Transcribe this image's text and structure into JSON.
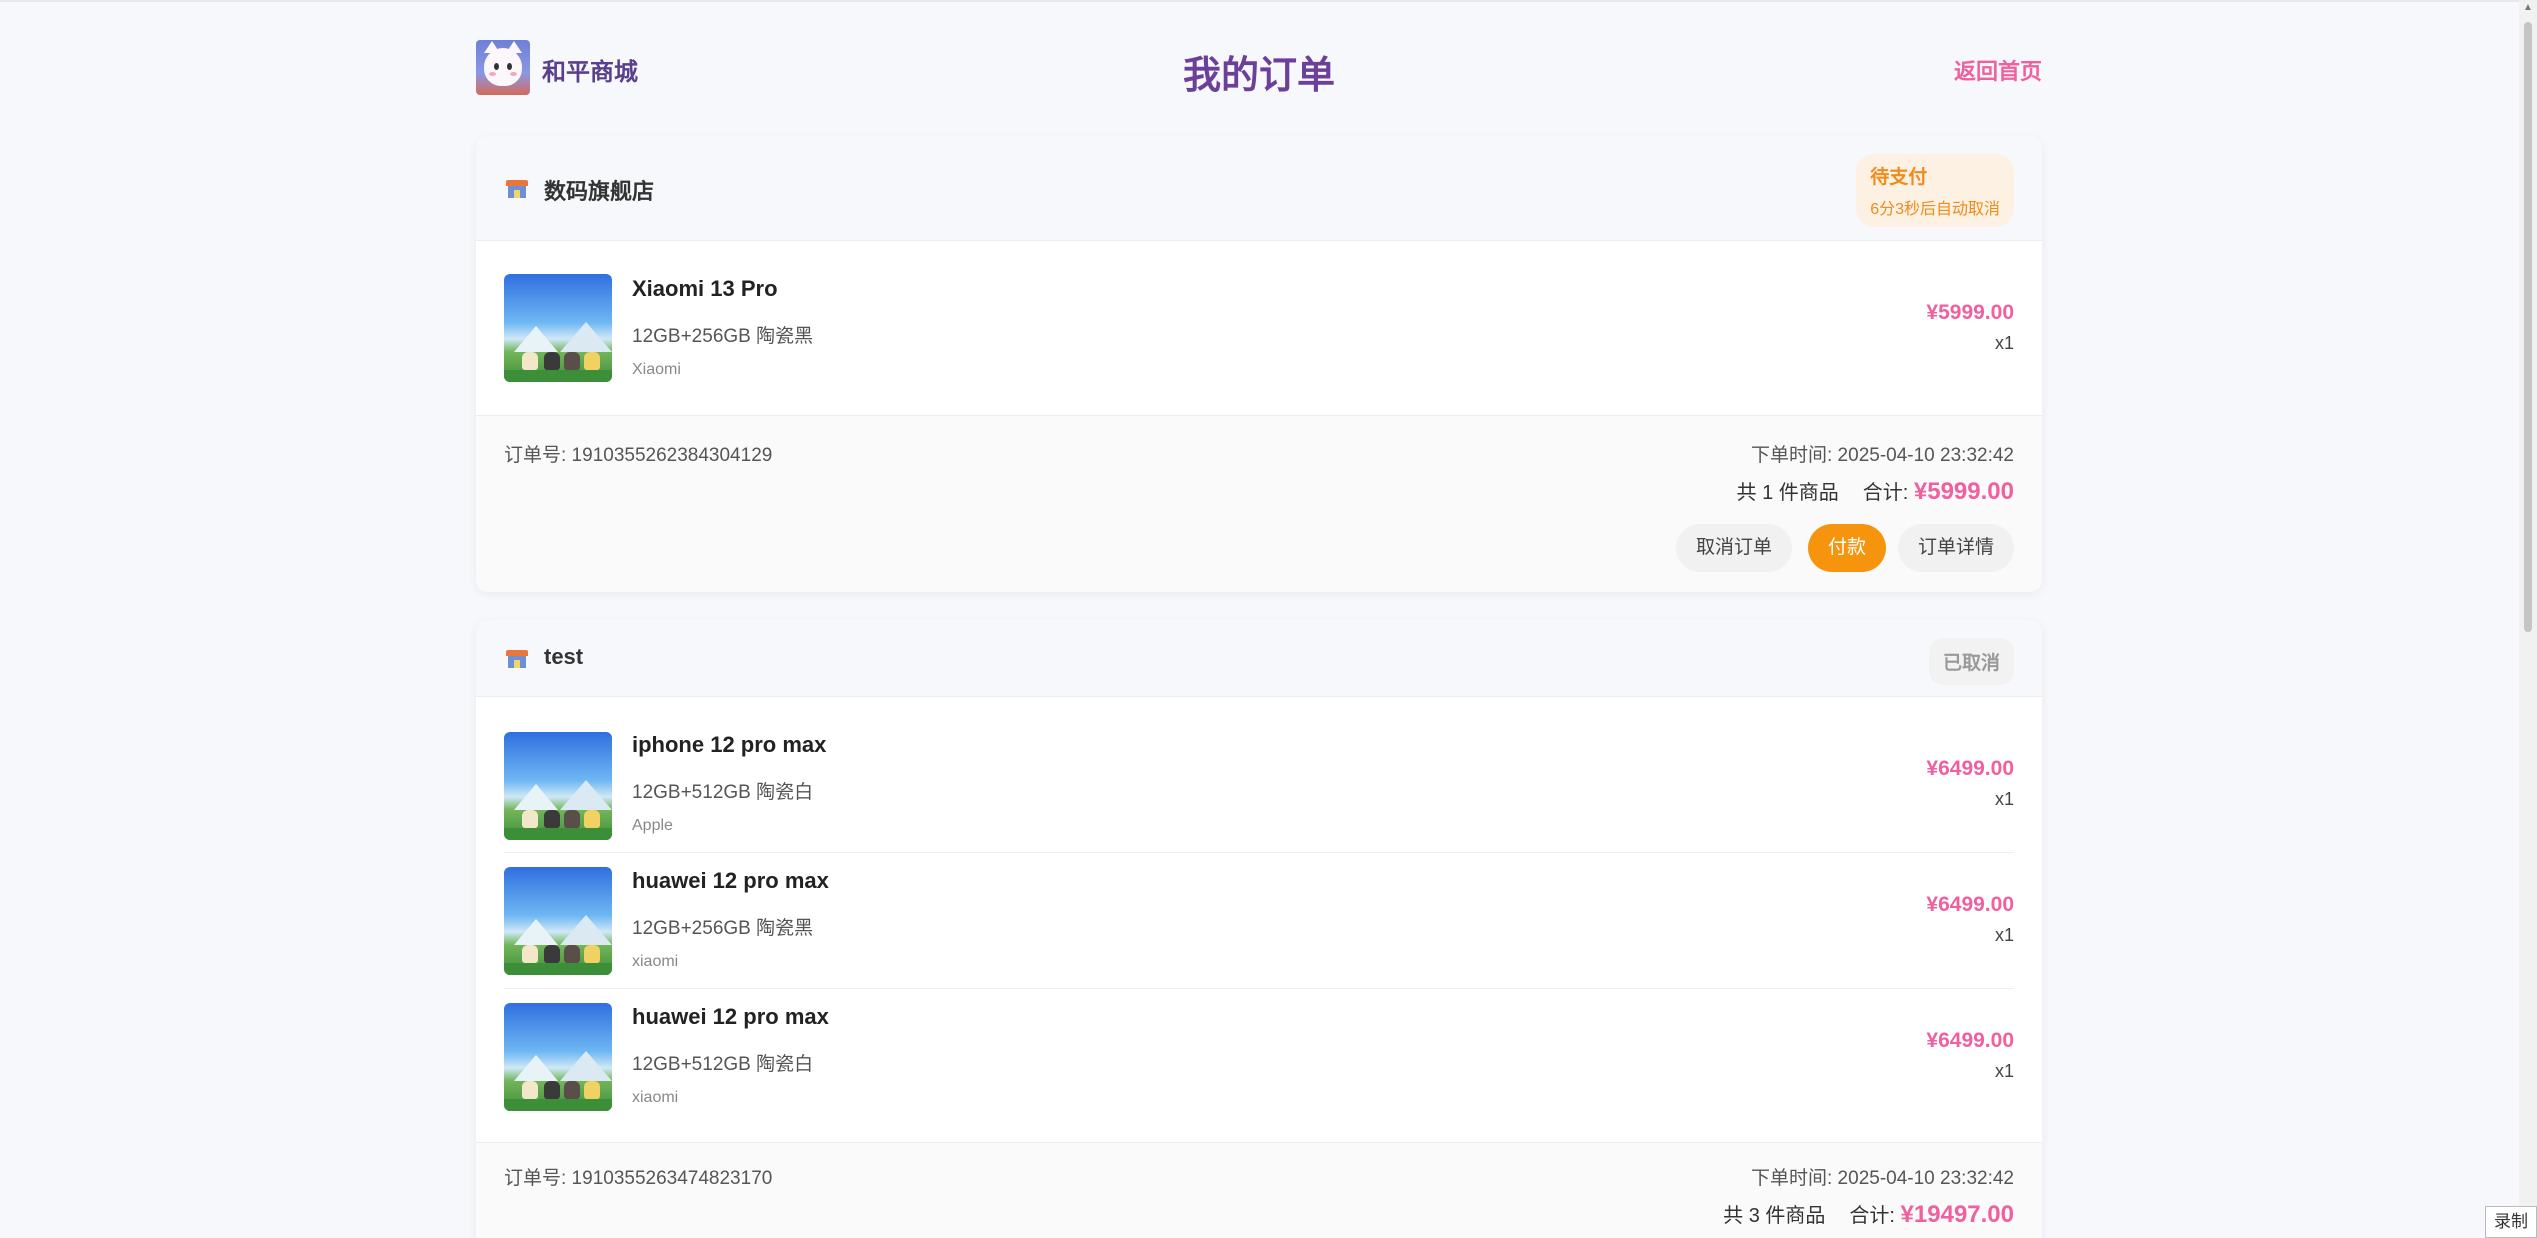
{
  "header": {
    "brand": "和平商城",
    "title": "我的订单",
    "home_link": "返回首页"
  },
  "orders": [
    {
      "store": "数码旗舰店",
      "status": "待支付",
      "countdown": "6分3秒后自动取消",
      "items": [
        {
          "name": "Xiaomi 13 Pro",
          "spec": "12GB+256GB 陶瓷黑",
          "brand": "Xiaomi",
          "price": "¥5999.00",
          "qty": "x1"
        }
      ],
      "order_no": "订单号: 1910355262384304129",
      "order_time": "下单时间: 2025-04-10 23:32:42",
      "count_text": "共 1 件商品",
      "total_label": "合计:",
      "total": "¥5999.00",
      "buttons": {
        "cancel": "取消订单",
        "pay": "付款",
        "detail": "订单详情"
      }
    },
    {
      "store": "test",
      "status": "已取消",
      "items": [
        {
          "name": "iphone 12 pro max",
          "spec": "12GB+512GB 陶瓷白",
          "brand": "Apple",
          "price": "¥6499.00",
          "qty": "x1"
        },
        {
          "name": "huawei 12 pro max",
          "spec": "12GB+256GB 陶瓷黑",
          "brand": "xiaomi",
          "price": "¥6499.00",
          "qty": "x1"
        },
        {
          "name": "huawei 12 pro max",
          "spec": "12GB+512GB 陶瓷白",
          "brand": "xiaomi",
          "price": "¥6499.00",
          "qty": "x1"
        }
      ],
      "order_no": "订单号: 1910355263474823170",
      "order_time": "下单时间: 2025-04-10 23:32:42",
      "count_text": "共 3 件商品",
      "total_label": "合计:",
      "total": "¥19497.00"
    }
  ],
  "record_badge": "录制",
  "colors": {
    "accent": "#f0609e",
    "title": "#6b3f9a",
    "pay": "#f6950d",
    "pending": "#f08a1a"
  }
}
